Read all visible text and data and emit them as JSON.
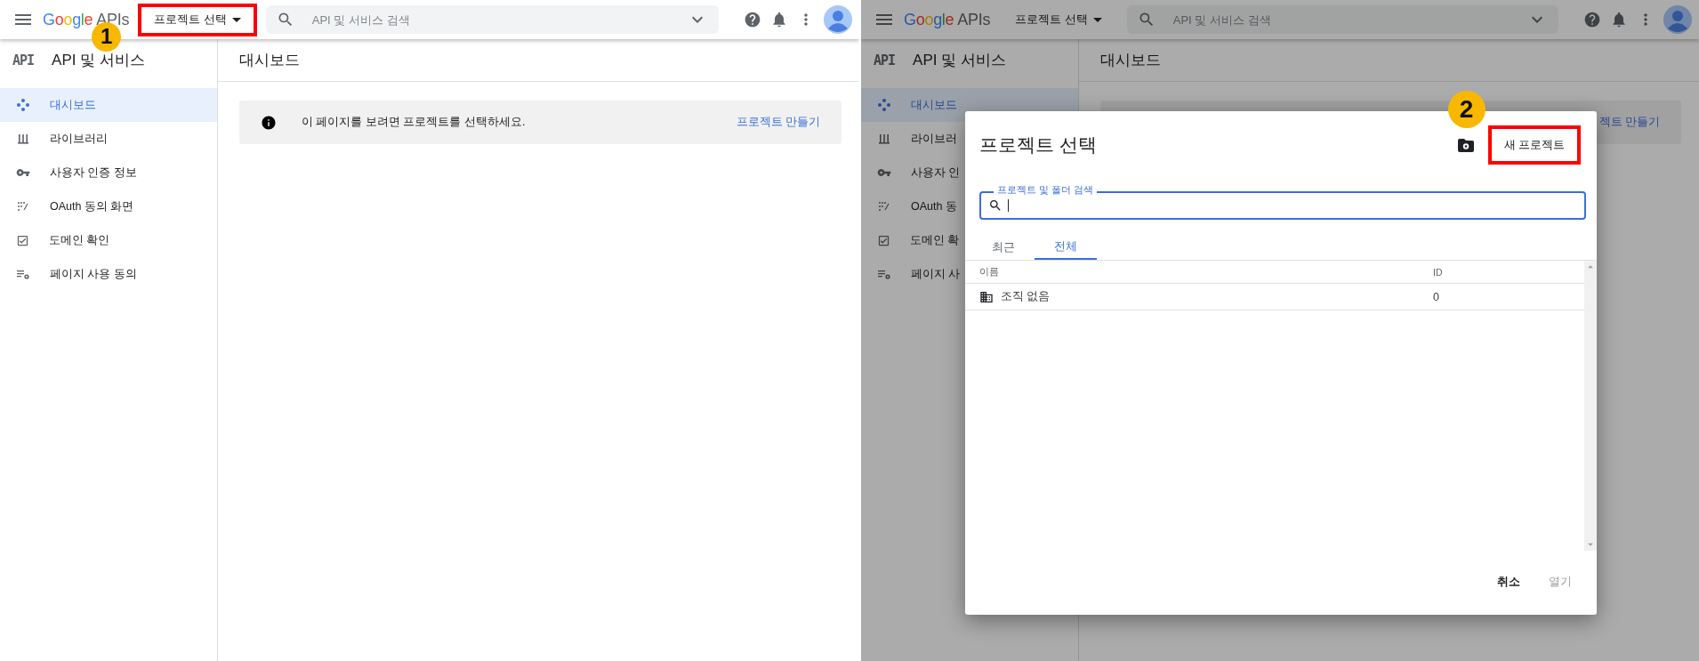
{
  "screens": [
    {
      "dimmed": false,
      "header": {
        "logo": {
          "brand": "Google",
          "product": "APIs"
        },
        "project_selector": {
          "label": "프로젝트 선택",
          "highlighted": true,
          "callout": "1"
        },
        "search": {
          "placeholder": "API 및 서비스 검색"
        }
      },
      "sidebar": {
        "badge": "API",
        "title": "API 및 서비스",
        "items": [
          {
            "label": "대시보드",
            "selected": true
          },
          {
            "label": "라이브러리",
            "selected": false
          },
          {
            "label": "사용자 인증 정보",
            "selected": false
          },
          {
            "label": "OAuth 동의 화면",
            "selected": false
          },
          {
            "label": "도메인 확인",
            "selected": false
          },
          {
            "label": "페이지 사용 동의",
            "selected": false
          }
        ]
      },
      "main": {
        "title": "대시보드",
        "banner": {
          "message": "이 페이지를 보려면 프로젝트를 선택하세요.",
          "link": "프로젝트 만들기"
        }
      }
    },
    {
      "dimmed": true,
      "header": {
        "logo": {
          "brand": "Google",
          "product": "APIs"
        },
        "project_selector": {
          "label": "프로젝트 선택",
          "highlighted": false
        },
        "search": {
          "placeholder": "API 및 서비스 검색"
        }
      },
      "sidebar": {
        "badge": "API",
        "title": "API 및 서비스",
        "items": [
          {
            "label": "대시보드",
            "selected": true
          },
          {
            "label": "라이브러",
            "selected": false
          },
          {
            "label": "사용자 인",
            "selected": false
          },
          {
            "label": "OAuth 동",
            "selected": false
          },
          {
            "label": "도메인 확",
            "selected": false
          },
          {
            "label": "페이지 사",
            "selected": false
          }
        ]
      },
      "main": {
        "title": "대시보드",
        "banner": {
          "link": "젝트 만들기"
        }
      },
      "dialog": {
        "title": "프로젝트 선택",
        "new_project": {
          "label": "새 프로젝트",
          "highlighted": true,
          "callout": "2"
        },
        "search": {
          "label": "프로젝트 및 폴더 검색"
        },
        "tabs": [
          {
            "label": "최근",
            "selected": false
          },
          {
            "label": "전체",
            "selected": true
          }
        ],
        "table": {
          "columns": [
            "이름",
            "ID"
          ],
          "rows": [
            {
              "name": "조직 없음",
              "id": "0"
            }
          ]
        },
        "buttons": [
          {
            "label": "취소",
            "disabled": false
          },
          {
            "label": "열기",
            "disabled": true
          }
        ]
      }
    }
  ]
}
